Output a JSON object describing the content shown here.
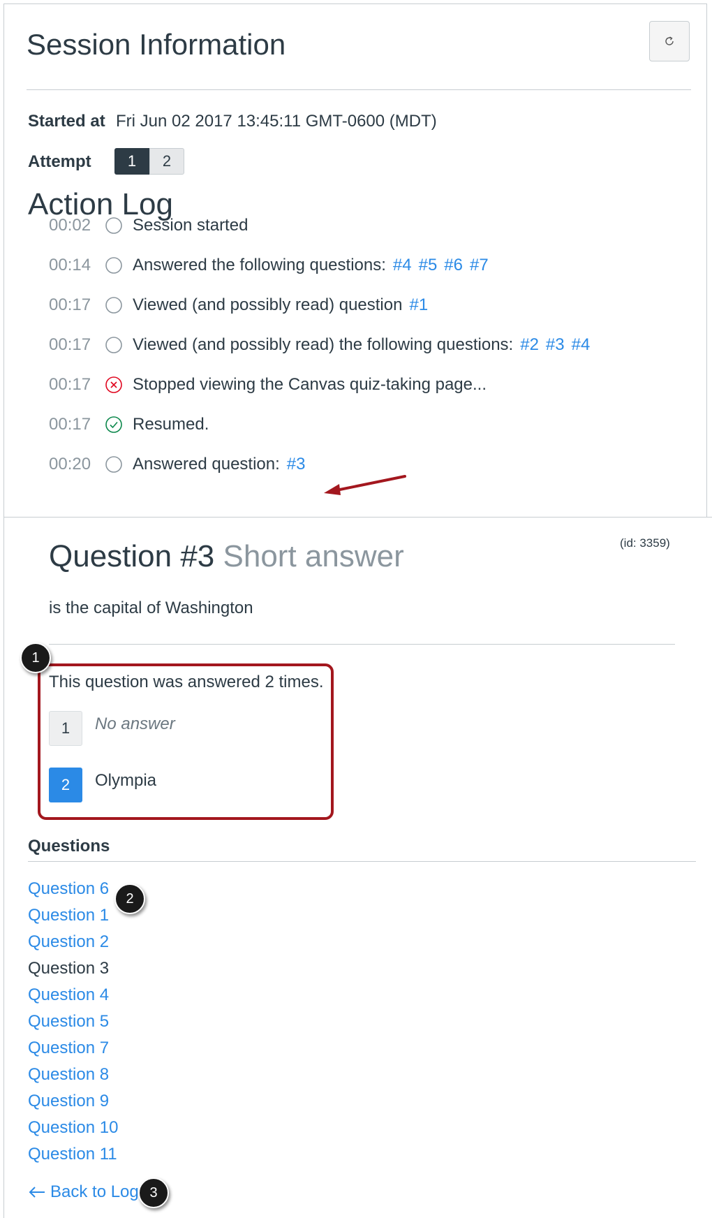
{
  "session": {
    "title": "Session Information",
    "started_label": "Started at",
    "started_value": "Fri Jun 02 2017 13:45:11 GMT-0600 (MDT)",
    "attempt_label": "Attempt",
    "attempts": [
      "1",
      "2"
    ],
    "active_attempt": "1"
  },
  "action_log": {
    "title": "Action Log",
    "entries": [
      {
        "time": "00:02",
        "icon": "empty-circle-icon",
        "text": "Session started",
        "links": []
      },
      {
        "time": "00:14",
        "icon": "empty-circle-icon",
        "text": "Answered the following questions:",
        "links": [
          "#4",
          "#5",
          "#6",
          "#7"
        ]
      },
      {
        "time": "00:17",
        "icon": "empty-circle-icon",
        "text": "Viewed (and possibly read) question",
        "links": [
          "#1"
        ]
      },
      {
        "time": "00:17",
        "icon": "empty-circle-icon",
        "text": "Viewed (and possibly read) the following questions:",
        "links": [
          "#2",
          "#3",
          "#4"
        ]
      },
      {
        "time": "00:17",
        "icon": "stopped-x-circle-icon",
        "text": "Stopped viewing the Canvas quiz-taking page...",
        "links": []
      },
      {
        "time": "00:17",
        "icon": "resumed-check-circle-icon",
        "text": "Resumed.",
        "links": []
      },
      {
        "time": "00:20",
        "icon": "empty-circle-icon",
        "text": "Answered question:",
        "links": [
          "#3"
        ]
      }
    ]
  },
  "question": {
    "title": "Question #3",
    "type": "Short answer",
    "id_text": "(id: 3359)",
    "text": "is the capital of Washington",
    "answered_text": "This question was answered 2 times.",
    "answers": [
      {
        "num": "1",
        "text": "No answer"
      },
      {
        "num": "2",
        "text": "Olympia"
      }
    ]
  },
  "questions_nav": {
    "heading": "Questions",
    "items": [
      "Question 6",
      "Question 1",
      "Question 2",
      "Question 3",
      "Question 4",
      "Question 5",
      "Question 7",
      "Question 8",
      "Question 9",
      "Question 10",
      "Question 11"
    ],
    "current": "Question 3",
    "back_label": "Back to Log"
  },
  "callouts": [
    "1",
    "2",
    "3"
  ],
  "colors": {
    "text": "#2d3b45",
    "link": "#2b8ae6",
    "muted": "#8b969e",
    "annotation_red": "#a3171e",
    "success": "#0b874b",
    "danger": "#e0061f"
  }
}
